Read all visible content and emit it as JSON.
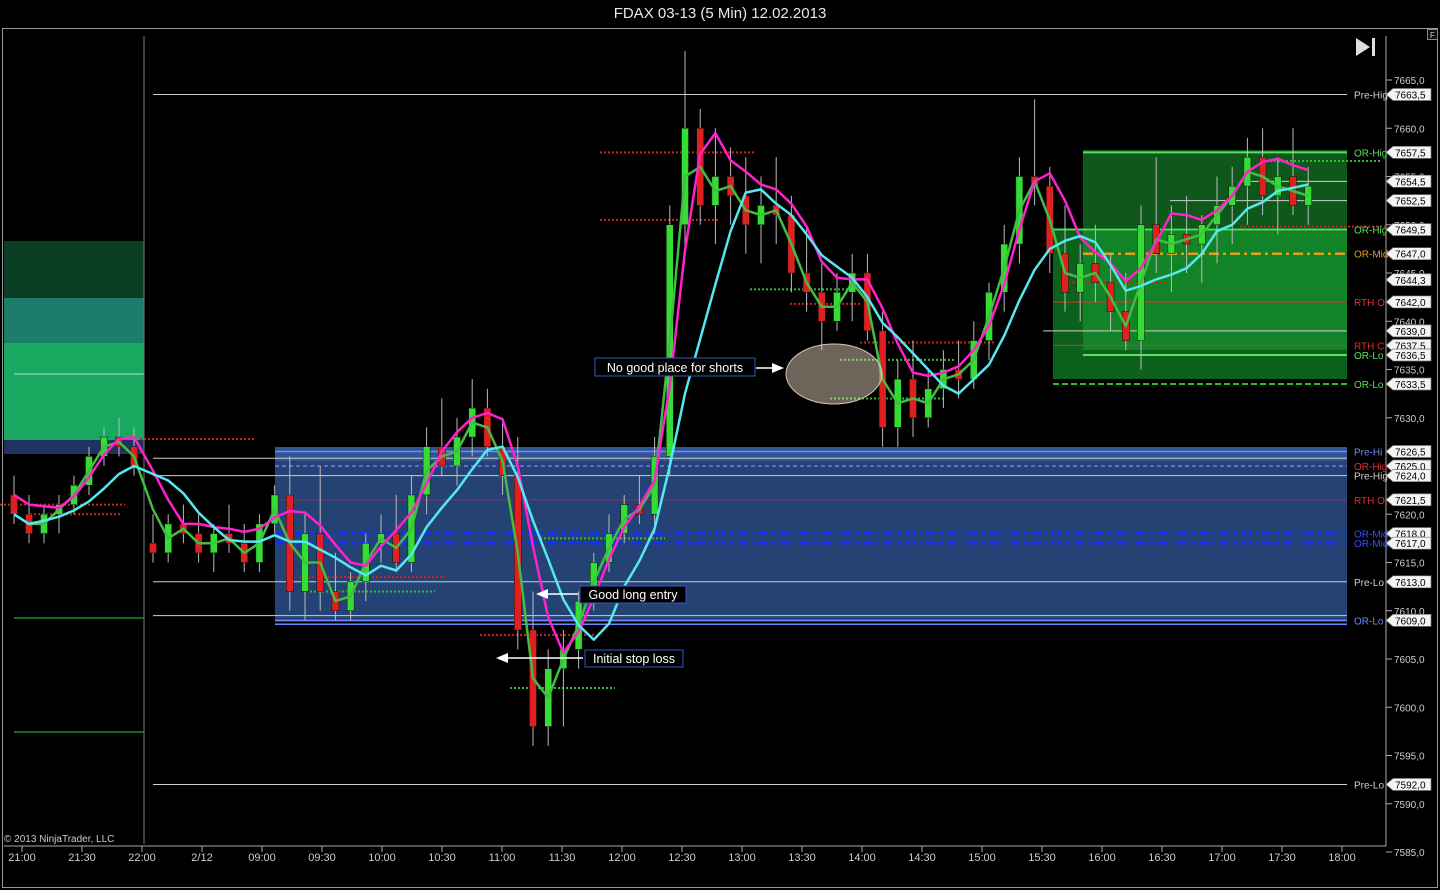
{
  "window": {
    "title": "FDAX 03-13 (5 Min)  12.02.2013"
  },
  "copyright": "© 2013 NinjaTrader, LLC",
  "controls": {
    "scroll_end_icon": "skip-to-end-icon",
    "panel_button_label": "F"
  },
  "chart_data": {
    "type": "candlestick",
    "title": "FDAX 03-13 (5 Min)  12.02.2013",
    "y_axis": {
      "ticks": [
        "7665,0",
        "7660,0",
        "7655,0",
        "7650,0",
        "7645,0",
        "7640,0",
        "7635,0",
        "7630,0",
        "7625,0",
        "7620,0",
        "7615,0",
        "7610,0",
        "7605,0",
        "7600,0",
        "7595,0",
        "7590,0",
        "7585,0"
      ],
      "range": [
        7585,
        7668
      ]
    },
    "x_axis": {
      "ticks": [
        "21:00",
        "21:30",
        "22:00",
        "2/12",
        "09:00",
        "09:30",
        "10:00",
        "10:30",
        "11:00",
        "11:30",
        "12:00",
        "12:30",
        "13:00",
        "13:30",
        "14:00",
        "14:30",
        "15:00",
        "15:30",
        "16:00",
        "16:30",
        "17:00",
        "17:30",
        "18:00"
      ]
    },
    "price_markers": [
      {
        "value": "7663,5",
        "label": "Pre-Hig",
        "color": "#cfcfcf"
      },
      {
        "value": "7657,5",
        "label": "OR-Hig",
        "color": "#5ee05e"
      },
      {
        "value": "7654,5",
        "label": "",
        "color": "#cfcfcf"
      },
      {
        "value": "7652,5",
        "label": "",
        "color": "#cfcfcf"
      },
      {
        "value": "7649,5",
        "label": "OR-Hig",
        "color": "#5ee05e"
      },
      {
        "value": "7647,0",
        "label": "OR-Mid",
        "color": "#e0a020"
      },
      {
        "value": "7644,3",
        "label": "",
        "color": "#cfcfcf"
      },
      {
        "value": "7642,0",
        "label": "RTH O",
        "color": "#e03030"
      },
      {
        "value": "7639,0",
        "label": "",
        "color": "#cfcfcf"
      },
      {
        "value": "7637,5",
        "label": "RTH C",
        "color": "#e03030"
      },
      {
        "value": "7636,5",
        "label": "OR-Lo",
        "color": "#5ee05e"
      },
      {
        "value": "7633,5",
        "label": "OR-Lo",
        "color": "#5ee05e"
      },
      {
        "value": "7626,5",
        "label": "Pre-Hi",
        "color": "#6a8cff"
      },
      {
        "value": "7625,0",
        "label": "OR-Hig",
        "color": "#e03030"
      },
      {
        "value": "7624,0",
        "label": "Pre-Hig",
        "color": "#cfcfcf"
      },
      {
        "value": "7621,5",
        "label": "RTH O",
        "color": "#e03030"
      },
      {
        "value": "7618,0",
        "label": "OR-Mid",
        "color": "#3050ff"
      },
      {
        "value": "7617,0",
        "label": "OR-Mid",
        "color": "#3050ff"
      },
      {
        "value": "7613,0",
        "label": "Pre-Lo",
        "color": "#cfcfcf"
      },
      {
        "value": "7609,0",
        "label": "OR-Lo",
        "color": "#6a8cff"
      },
      {
        "value": "7592,0",
        "label": "Pre-Lo",
        "color": "#cfcfcf"
      }
    ],
    "annotations": [
      {
        "text": "No good place for shorts"
      },
      {
        "text": "Good long entry"
      },
      {
        "text": "Initial stop loss"
      }
    ],
    "series": [
      {
        "color": "#33dd33",
        "type": "candlestick"
      },
      {
        "color": "#ff22cc",
        "type": "line"
      },
      {
        "color": "#55e8f0",
        "type": "line"
      },
      {
        "color": "#44bb44",
        "type": "line"
      }
    ],
    "candles": [
      [
        7622,
        7624,
        7619,
        7620
      ],
      [
        7620,
        7622,
        7617,
        7618
      ],
      [
        7618,
        7621,
        7617,
        7620
      ],
      [
        7620,
        7622,
        7618,
        7621
      ],
      [
        7621,
        7624,
        7620,
        7623
      ],
      [
        7623,
        7627,
        7622,
        7626
      ],
      [
        7626,
        7629,
        7625,
        7628
      ],
      [
        7628,
        7630,
        7626,
        7627
      ],
      [
        7627,
        7629,
        7624,
        7625
      ],
      [
        7617,
        7620,
        7615,
        7616
      ],
      [
        7616,
        7620,
        7615,
        7619
      ],
      [
        7619,
        7621,
        7617,
        7618
      ],
      [
        7618,
        7620,
        7615,
        7616
      ],
      [
        7616,
        7619,
        7614,
        7618
      ],
      [
        7618,
        7621,
        7616,
        7617
      ],
      [
        7617,
        7619,
        7614,
        7615
      ],
      [
        7615,
        7620,
        7614,
        7619
      ],
      [
        7619,
        7623,
        7618,
        7622
      ],
      [
        7622,
        7626,
        7610,
        7612
      ],
      [
        7612,
        7620,
        7609,
        7618
      ],
      [
        7618,
        7625,
        7610,
        7612
      ],
      [
        7612,
        7616,
        7609,
        7610
      ],
      [
        7610,
        7614,
        7609,
        7613
      ],
      [
        7613,
        7618,
        7611,
        7617
      ],
      [
        7617,
        7620,
        7615,
        7618
      ],
      [
        7618,
        7622,
        7614,
        7615
      ],
      [
        7615,
        7624,
        7614,
        7622
      ],
      [
        7622,
        7629,
        7620,
        7627
      ],
      [
        7627,
        7632,
        7624,
        7625
      ],
      [
        7625,
        7630,
        7623,
        7628
      ],
      [
        7628,
        7634,
        7626,
        7631
      ],
      [
        7631,
        7633,
        7626,
        7627
      ],
      [
        7627,
        7630,
        7622,
        7624
      ],
      [
        7624,
        7628,
        7606,
        7608
      ],
      [
        7608,
        7612,
        7596,
        7598
      ],
      [
        7598,
        7606,
        7596,
        7604
      ],
      [
        7604,
        7608,
        7598,
        7606
      ],
      [
        7606,
        7612,
        7604,
        7611
      ],
      [
        7611,
        7616,
        7610,
        7615
      ],
      [
        7615,
        7620,
        7614,
        7618
      ],
      [
        7618,
        7622,
        7617,
        7621
      ],
      [
        7621,
        7624,
        7619,
        7620
      ],
      [
        7620,
        7628,
        7618,
        7626
      ],
      [
        7626,
        7652,
        7624,
        7650
      ],
      [
        7650,
        7668,
        7647,
        7660
      ],
      [
        7660,
        7662,
        7650,
        7652
      ],
      [
        7652,
        7660,
        7648,
        7655
      ],
      [
        7655,
        7658,
        7650,
        7653
      ],
      [
        7653,
        7657,
        7647,
        7650
      ],
      [
        7650,
        7655,
        7646,
        7652
      ],
      [
        7652,
        7657,
        7648,
        7651
      ],
      [
        7651,
        7653,
        7643,
        7645
      ],
      [
        7645,
        7650,
        7641,
        7643
      ],
      [
        7643,
        7646,
        7637,
        7640
      ],
      [
        7640,
        7645,
        7639,
        7643
      ],
      [
        7643,
        7647,
        7640,
        7645
      ],
      [
        7645,
        7647,
        7638,
        7639
      ],
      [
        7639,
        7641,
        7627,
        7629
      ],
      [
        7629,
        7636,
        7627,
        7634
      ],
      [
        7634,
        7638,
        7628,
        7630
      ],
      [
        7630,
        7635,
        7629,
        7633
      ],
      [
        7633,
        7637,
        7631,
        7635
      ],
      [
        7635,
        7638,
        7632,
        7634
      ],
      [
        7634,
        7640,
        7633,
        7638
      ],
      [
        7638,
        7644,
        7636,
        7643
      ],
      [
        7643,
        7650,
        7641,
        7648
      ],
      [
        7648,
        7657,
        7646,
        7655
      ],
      [
        7655,
        7663,
        7652,
        7654
      ],
      [
        7654,
        7656,
        7645,
        7647
      ],
      [
        7647,
        7652,
        7641,
        7643
      ],
      [
        7643,
        7648,
        7640,
        7646
      ],
      [
        7646,
        7650,
        7642,
        7644
      ],
      [
        7644,
        7647,
        7639,
        7641
      ],
      [
        7641,
        7645,
        7637,
        7638
      ],
      [
        7638,
        7652,
        7635,
        7650
      ],
      [
        7650,
        7657,
        7645,
        7647
      ],
      [
        7647,
        7652,
        7643,
        7649
      ],
      [
        7649,
        7653,
        7645,
        7648
      ],
      [
        7648,
        7651,
        7644,
        7650
      ],
      [
        7650,
        7655,
        7646,
        7652
      ],
      [
        7652,
        7656,
        7648,
        7654
      ],
      [
        7654,
        7659,
        7650,
        7657
      ],
      [
        7657,
        7660,
        7651,
        7653
      ],
      [
        7653,
        7657,
        7649,
        7655
      ],
      [
        7655,
        7660,
        7651,
        7652
      ],
      [
        7652,
        7656,
        7650,
        7654
      ]
    ]
  }
}
